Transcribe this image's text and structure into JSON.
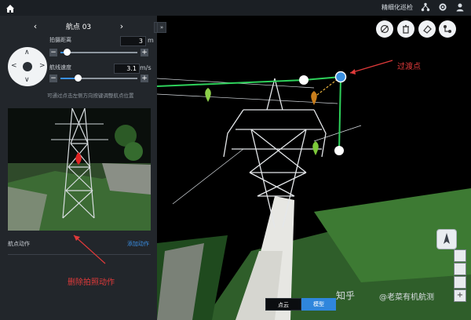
{
  "topbar": {
    "title": "精细化巡检",
    "icons": [
      "home-icon",
      "network-icon",
      "settings-icon",
      "user-icon"
    ]
  },
  "panel": {
    "nav": {
      "prev": "‹",
      "title": "航点 03",
      "next": "›"
    },
    "params": [
      {
        "label": "拍摄距离",
        "value": "3",
        "unit": "m",
        "slider_fraction": 0.08
      },
      {
        "label": "航线速度",
        "value": "3.1",
        "unit": "m/s",
        "slider_fraction": 0.22
      }
    ],
    "hint": "可通过点击左侧方向按键调整航点位置",
    "action_label": "航点动作",
    "add_action": "添加动作",
    "collapse": "«"
  },
  "scene": {
    "toolbar_icons": [
      "visibility-icon",
      "delete-icon",
      "eraser-icon",
      "route-icon"
    ],
    "right_controls": [
      "layers-icon",
      "globe-icon",
      "shield-icon",
      "plus-icon"
    ],
    "expand": "»"
  },
  "annotations": {
    "transition_point": "过渡点",
    "delete_photo_action": "删除拍照动作"
  },
  "bottom_tabs": [
    {
      "label": "点云",
      "active": false
    },
    {
      "label": "模型",
      "active": true
    }
  ],
  "watermark": {
    "site": "知乎",
    "author": "@老菜有机航测"
  }
}
